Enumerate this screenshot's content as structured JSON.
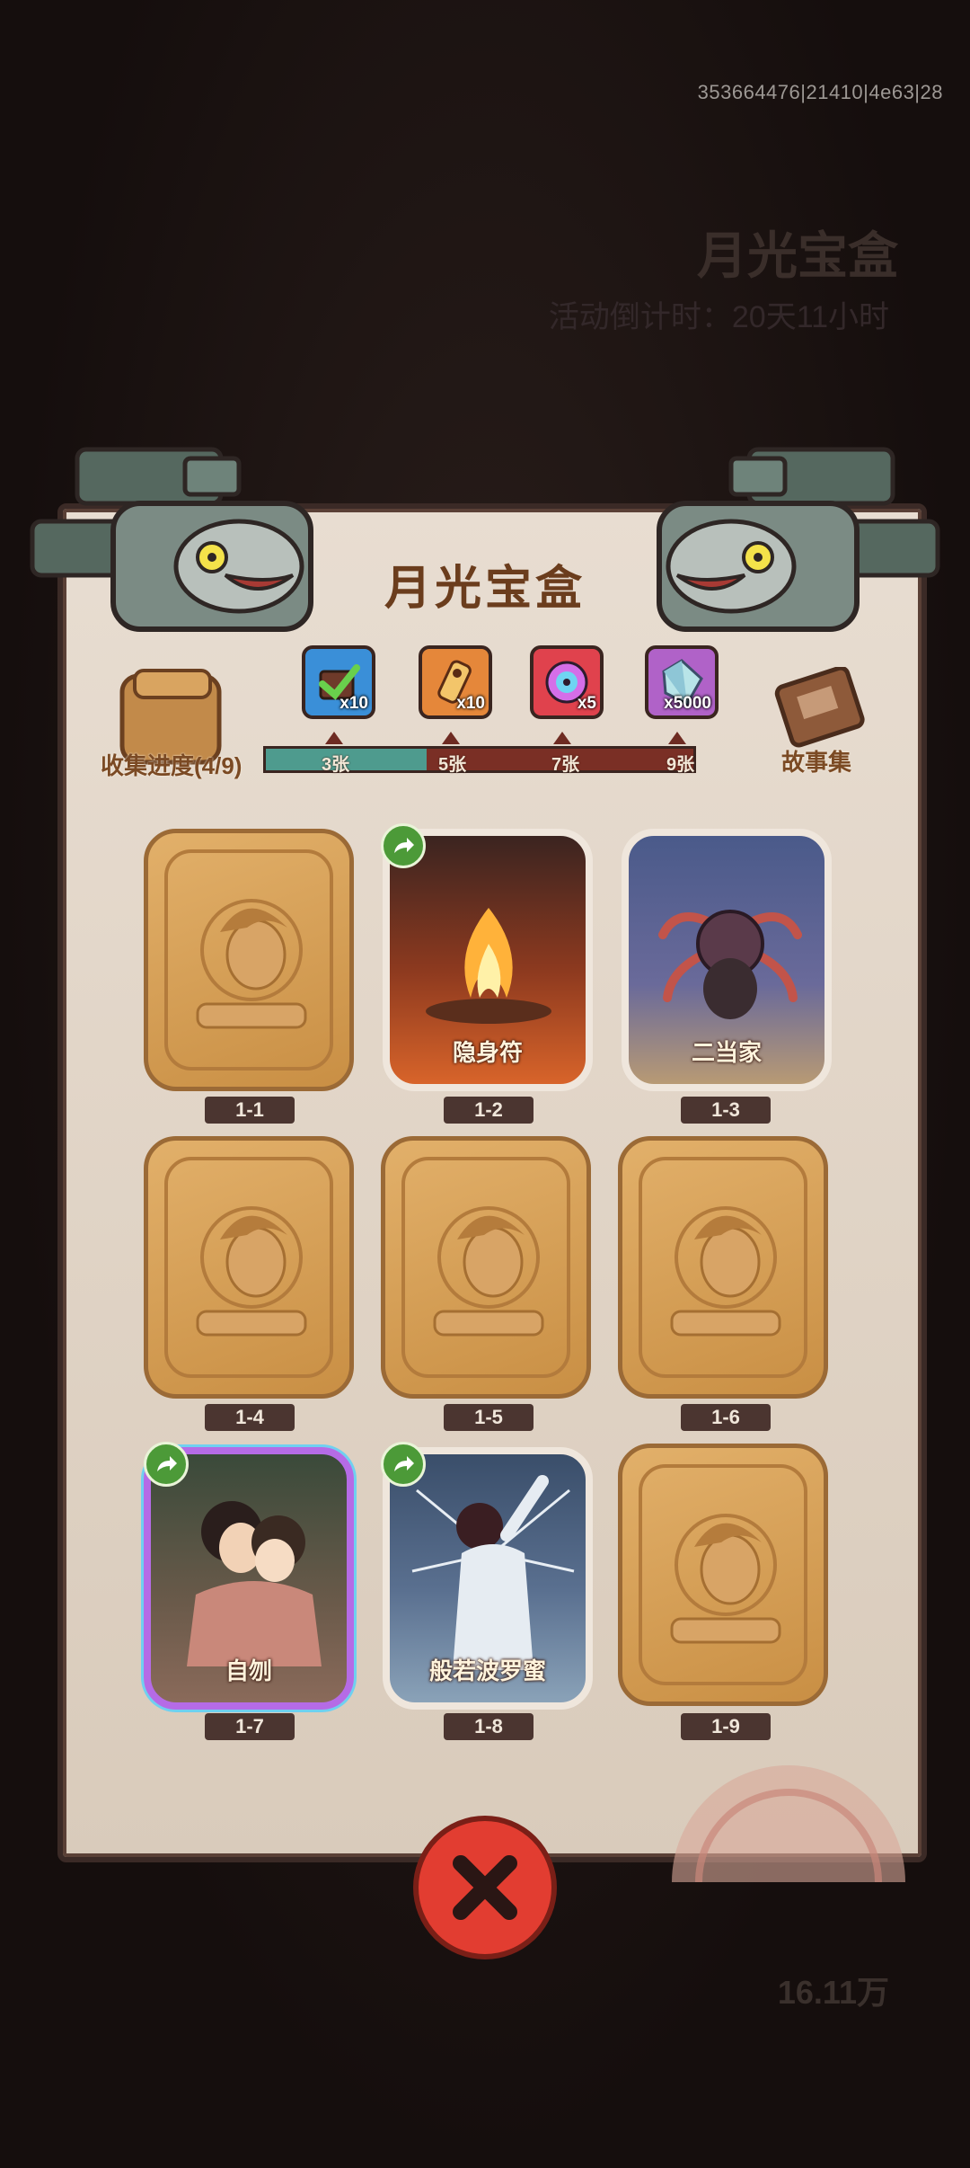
{
  "build_id": "353664476|21410|4e63|28",
  "background": {
    "event_title": "月光宝盒",
    "countdown": "活动倒计时：20天11小时",
    "currency": "16.11万"
  },
  "panel": {
    "title": "月光宝盒",
    "progress_label": "收集进度(4/9)",
    "story_label": "故事集",
    "collected": 4,
    "total": 9
  },
  "rewards": [
    {
      "icon": "checkmark-box-icon",
      "qty": "x10",
      "milestone": "3张",
      "color": "#3a8fd8"
    },
    {
      "icon": "scroll-key-icon",
      "qty": "x10",
      "milestone": "5张",
      "color": "#e5873a"
    },
    {
      "icon": "disc-icon",
      "qty": "x5",
      "milestone": "7张",
      "color": "#e0424d"
    },
    {
      "icon": "crystal-icon",
      "qty": "x5000",
      "milestone": "9张",
      "color": "#b062c8"
    }
  ],
  "cards": [
    {
      "id": "1-1",
      "name": "",
      "state": "locked"
    },
    {
      "id": "1-2",
      "name": "隐身符",
      "state": "unlocked",
      "share": true
    },
    {
      "id": "1-3",
      "name": "二当家",
      "state": "unlocked",
      "share": false
    },
    {
      "id": "1-4",
      "name": "",
      "state": "locked"
    },
    {
      "id": "1-5",
      "name": "",
      "state": "locked"
    },
    {
      "id": "1-6",
      "name": "",
      "state": "locked"
    },
    {
      "id": "1-7",
      "name": "自刎",
      "state": "unlocked-rare",
      "share": true
    },
    {
      "id": "1-8",
      "name": "般若波罗蜜",
      "state": "unlocked",
      "share": true
    },
    {
      "id": "1-9",
      "name": "",
      "state": "locked"
    }
  ],
  "close_label": "close"
}
